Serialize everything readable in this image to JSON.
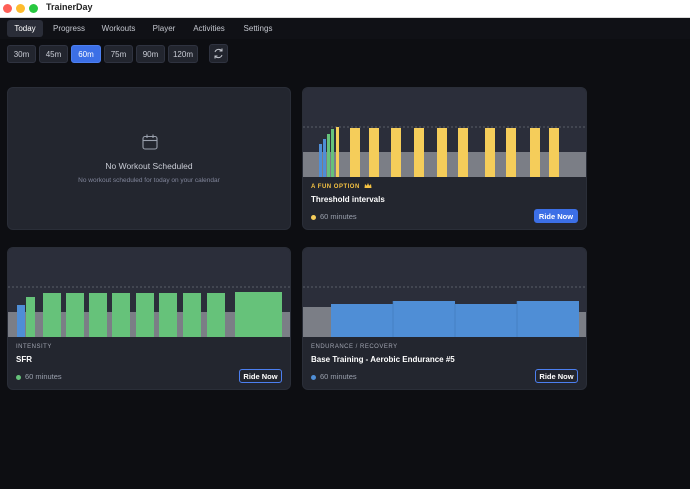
{
  "window": {
    "title": "TrainerDay"
  },
  "nav": {
    "tabs": [
      {
        "label": "Today",
        "active": true
      },
      {
        "label": "Progress",
        "active": false
      },
      {
        "label": "Workouts",
        "active": false
      },
      {
        "label": "Player",
        "active": false
      },
      {
        "label": "Activities",
        "active": false
      },
      {
        "label": "Settings",
        "active": false
      }
    ]
  },
  "durations": [
    {
      "label": "30m",
      "active": false
    },
    {
      "label": "45m",
      "active": false
    },
    {
      "label": "60m",
      "active": true
    },
    {
      "label": "75m",
      "active": false
    },
    {
      "label": "90m",
      "active": false
    },
    {
      "label": "120m",
      "active": false
    }
  ],
  "refresh_icon": "refresh-icon",
  "colors": {
    "accent": "#3c6fe6",
    "yellow": "#f5cd5a",
    "green": "#66c27a",
    "blue": "#4f8ed6",
    "grey": "#7b7e86"
  },
  "empty_card": {
    "icon": "calendar-icon",
    "title": "No Workout Scheduled",
    "subtitle": "No workout scheduled for today on your calendar"
  },
  "workouts": [
    {
      "tag": "A FUN OPTION",
      "tag_icon": "crown-icon",
      "name": "Threshold intervals",
      "duration": "60 minutes",
      "dot_color": "#f5cd5a",
      "button": "Ride Now"
    },
    {
      "tag": "INTENSITY",
      "name": "SFR",
      "duration": "60 minutes",
      "dot_color": "#66c27a",
      "button": "Ride Now"
    },
    {
      "tag": "ENDURANCE / RECOVERY",
      "name": "Base Training - Aerobic Endurance #5",
      "duration": "60 minutes",
      "dot_color": "#4f8ed6",
      "button": "Ride Now"
    }
  ]
}
